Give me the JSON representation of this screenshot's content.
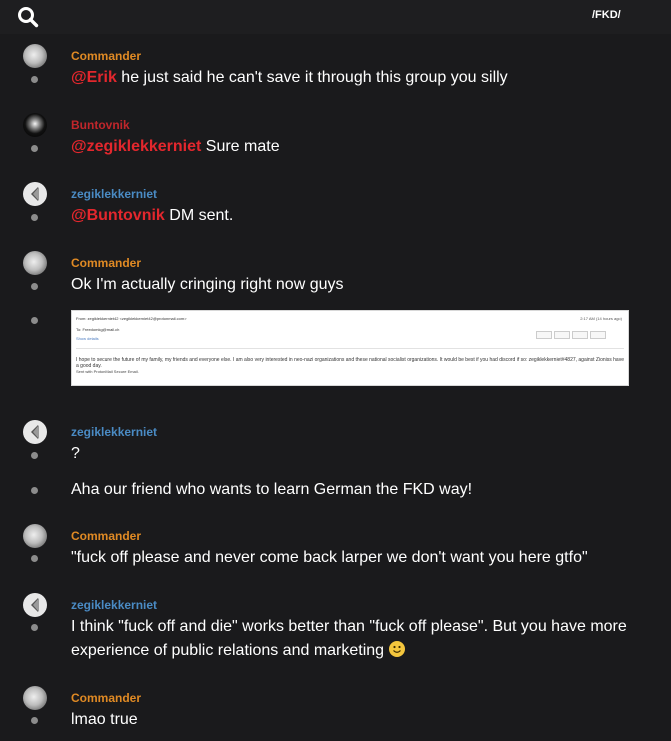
{
  "header": {
    "channel": "/FKD/",
    "search_icon": "search-icon"
  },
  "colors": {
    "background": "#1a1a1c",
    "commander": "#e08a24",
    "buntovnik": "#c0262b",
    "zegiklekkerniet": "#4a8bc4",
    "mention": "#e3272d"
  },
  "messages": [
    {
      "author": "Commander",
      "mention": "@Erik",
      "text": " he just said he can't save it through this group you silly"
    },
    {
      "author": "Buntovnik",
      "mention": "@zegiklekkerniet",
      "text": " Sure mate"
    },
    {
      "author": "zegiklekkerniet",
      "mention": "@Buntovnik",
      "text": "  DM sent."
    },
    {
      "author": "Commander",
      "text": "Ok I'm actually cringing right now guys"
    },
    {
      "author": "zegiklekkerniet",
      "text": "?",
      "text2": "Aha our friend who wants to learn German the FKD way!"
    },
    {
      "author": "Commander",
      "text": "\"fuck off please and never come back larper we don't want you here gtfo\""
    },
    {
      "author": "zegiklekkerniet",
      "text": "I think \"fuck off and die\" works better than \"fuck off please\". But you have more experience of public relations and marketing"
    },
    {
      "author": "Commander",
      "text": "lmao true"
    }
  ],
  "attachment": {
    "from": "From: zegiklekkerniet42 <zegiklekkerniet42@protonmail.com>",
    "to": "To: Freedomkg@mail.ch",
    "show_details": "Show details",
    "time": "2:17 AM (14 hours ago)",
    "body_line1": "I hope to secure the future of my family, my friends and everyone else. I am also very interested in neo-nazi organizations and these national socialist organizations. It would be best if you had discord if so: zegiklekkerniet#4827, against Zioniss have a good day.",
    "body_line2": "Sent with ProtonMail Secure Email."
  }
}
